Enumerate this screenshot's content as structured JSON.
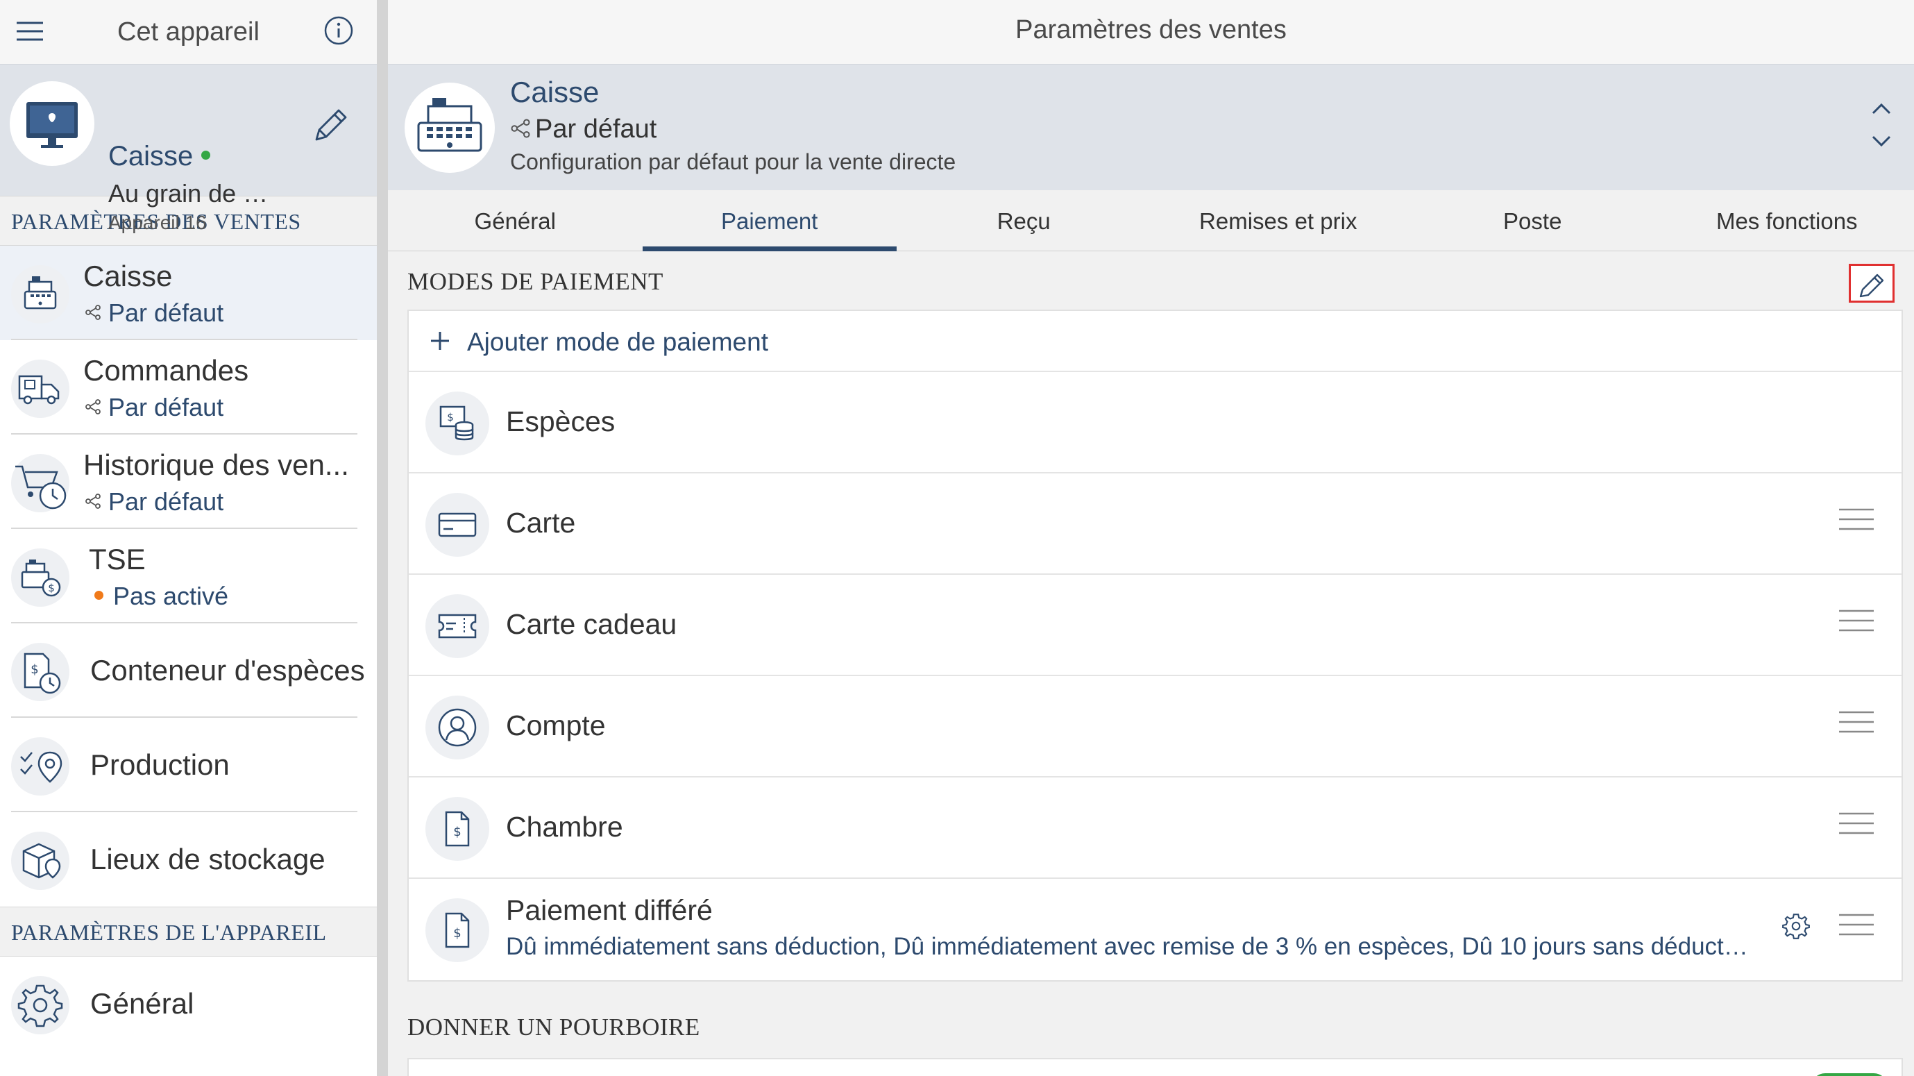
{
  "sidebar": {
    "title": "Cet appareil",
    "device": {
      "name": "Caisse",
      "store": "Au grain de ca...",
      "device_label": "Appareil 16",
      "status_color": "#34a745"
    },
    "section_sales": "PARAMÈTRES DES VENTES",
    "items": [
      {
        "label": "Caisse",
        "sub": "Par défaut",
        "icon": "cash-register-icon"
      },
      {
        "label": "Commandes",
        "sub": "Par défaut",
        "icon": "delivery-truck-icon"
      },
      {
        "label": "Historique des ven...",
        "sub": "Par défaut",
        "icon": "cart-history-icon"
      },
      {
        "label": "TSE",
        "sub": "Pas activé",
        "icon": "register-coin-icon"
      },
      {
        "label": "Conteneur d'espèces",
        "icon": "cash-container-icon"
      },
      {
        "label": "Production",
        "icon": "production-checklist-icon"
      },
      {
        "label": "Lieux de stockage",
        "icon": "storage-box-icon"
      }
    ],
    "section_device": "PARAMÈTRES DE L'APPAREIL",
    "device_items": [
      {
        "label": "Général",
        "icon": "gear-icon"
      }
    ]
  },
  "main": {
    "title": "Paramètres des ventes",
    "config": {
      "name": "Caisse",
      "profile": "Par défaut",
      "description": "Configuration par défaut pour la vente directe"
    },
    "tabs": [
      {
        "label": "Général"
      },
      {
        "label": "Paiement"
      },
      {
        "label": "Reçu"
      },
      {
        "label": "Remises et prix"
      },
      {
        "label": "Poste"
      },
      {
        "label": "Mes fonctions"
      }
    ],
    "active_tab": "Paiement",
    "payment_section_title": "MODES DE PAIEMENT",
    "add_label": "Ajouter mode de paiement",
    "methods": [
      {
        "label": "Espèces",
        "icon": "cash-coins-icon"
      },
      {
        "label": "Carte",
        "icon": "credit-card-icon"
      },
      {
        "label": "Carte cadeau",
        "icon": "gift-card-icon"
      },
      {
        "label": "Compte",
        "icon": "account-user-icon"
      },
      {
        "label": "Chambre",
        "icon": "room-invoice-icon"
      },
      {
        "label": "Paiement différé",
        "sub": "Dû immédiatement sans déduction, Dû immédiatement avec remise de 3 % en espèces, Dû 10 jours sans déduction, Dû 1...",
        "icon": "deferred-invoice-icon"
      }
    ],
    "tip_section_title": "DONNER UN POURBOIRE"
  },
  "colors": {
    "accent": "#2d4a6e",
    "highlight_border": "#e03030",
    "status_green": "#34a745",
    "status_orange": "#f07a1a"
  }
}
